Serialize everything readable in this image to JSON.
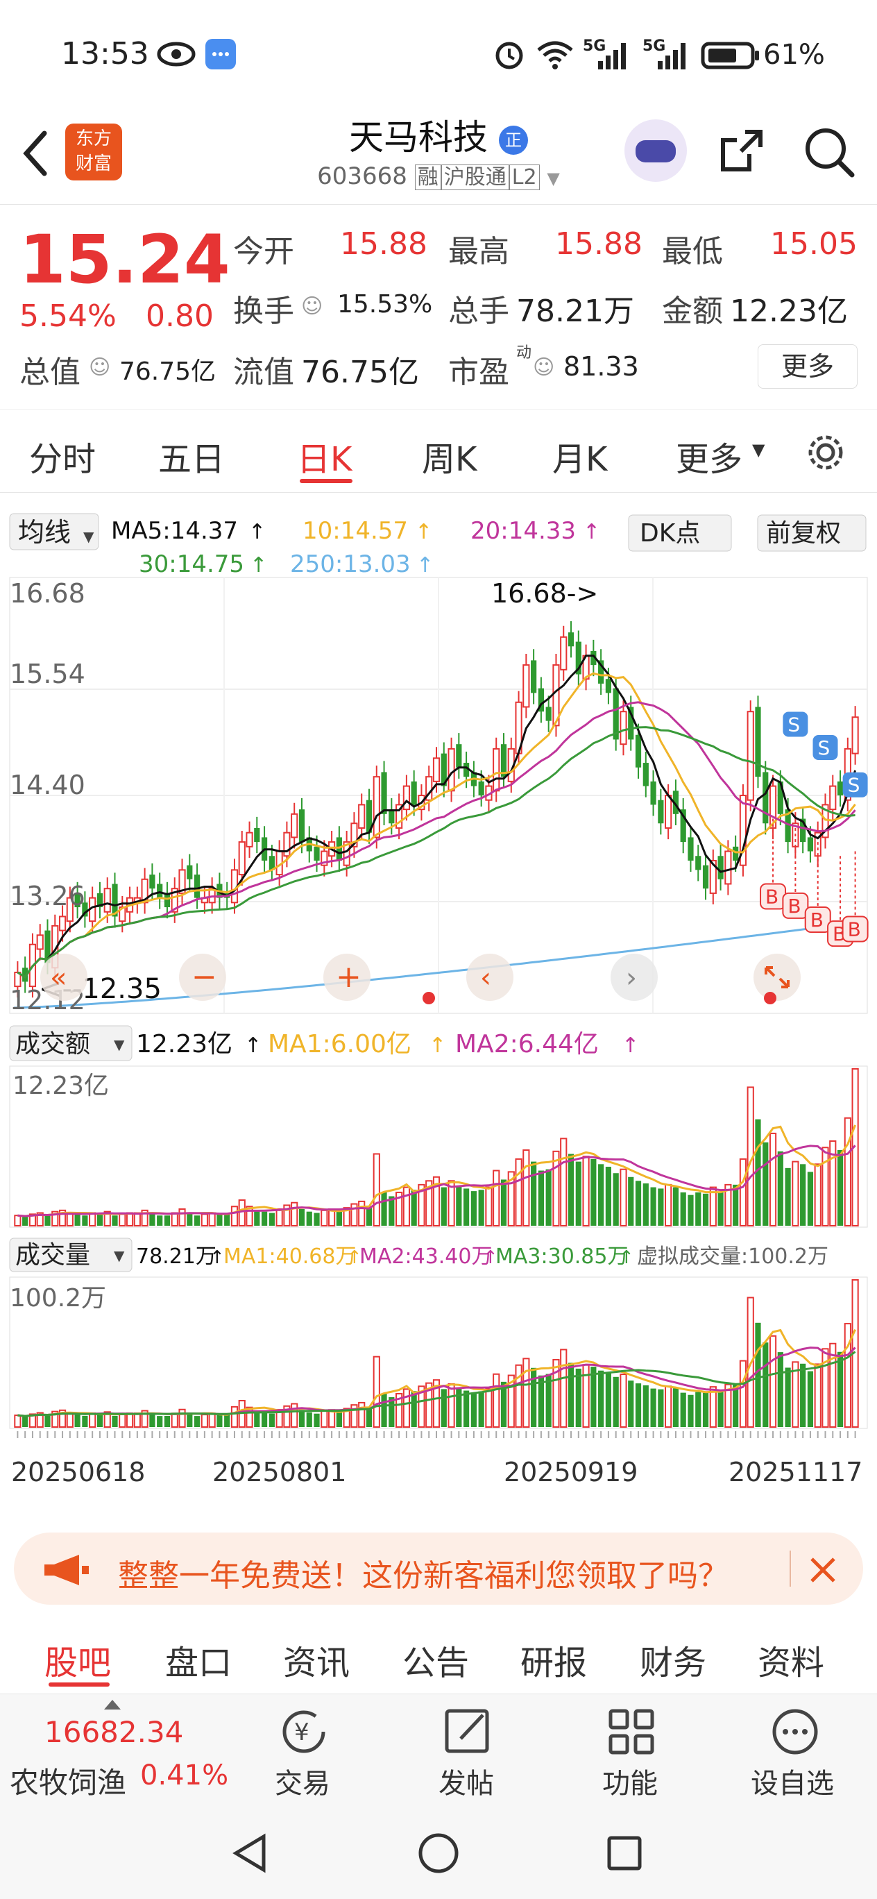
{
  "status": {
    "time": "13:53",
    "battery": "61%",
    "net1": "5G",
    "net2": "5G"
  },
  "header": {
    "title": "天马科技",
    "title_badge": "正",
    "code": "603668",
    "tags": [
      "融",
      "沪股通",
      "L2"
    ],
    "logo_top": "东方",
    "logo_bottom": "财富"
  },
  "quote": {
    "price": "15.24",
    "change_pct": "5.54%",
    "change": "0.80",
    "open_label": "今开",
    "open": "15.88",
    "high_label": "最高",
    "high": "15.88",
    "low_label": "最低",
    "low": "15.05",
    "turnover_label": "换手",
    "turnover": "15.53%",
    "volume_label": "总手",
    "volume": "78.21万",
    "amount_label": "金额",
    "amount": "12.23亿",
    "mcap_label": "总值",
    "mcap": "76.75亿",
    "float_label": "流值",
    "float": "76.75亿",
    "pe_label": "市盈",
    "pe_sup": "动",
    "pe": "81.33",
    "more": "更多"
  },
  "tabs": [
    "分时",
    "五日",
    "日K",
    "周K",
    "月K",
    "更多"
  ],
  "active_tab": "日K",
  "ma": {
    "selector": "均线",
    "ma5": "MA5:14.37",
    "ma10": "10:14.57",
    "ma20": "20:14.33",
    "ma30": "30:14.75",
    "ma250": "250:13.03",
    "dk": "DK点",
    "adj": "前复权"
  },
  "price_axis": [
    "16.68",
    "15.54",
    "14.40",
    "13.26",
    "12.12"
  ],
  "annot_high": "16.68->",
  "annot_low": "<--12.35",
  "amount_panel": {
    "selector": "成交额",
    "value": "12.23亿",
    "ma1": "MA1:6.00亿",
    "ma2": "MA2:6.44亿",
    "axis": "12.23亿"
  },
  "volume_panel": {
    "selector": "成交量",
    "value": "78.21万",
    "ma1": "MA1:40.68万",
    "ma2": "MA2:43.40万",
    "ma3": "MA3:30.85万",
    "virtual": "虚拟成交量:100.2万",
    "axis": "100.2万"
  },
  "dates": [
    "20250618",
    "20250801",
    "20250919",
    "20251117"
  ],
  "banner": {
    "text": "整整一年免费送！这份新客福利您领取了吗？"
  },
  "bottom_tabs": [
    "股吧",
    "盘口",
    "资讯",
    "公告",
    "研报",
    "财务",
    "资料"
  ],
  "index": {
    "value": "16682.34",
    "name": "农牧饲渔",
    "pct": "0.41%"
  },
  "toolbar": {
    "trade": "交易",
    "post": "发帖",
    "func": "功能",
    "watch": "设自选"
  },
  "colors": {
    "up": "#e63434",
    "down": "#2e9a30",
    "ma5": "#111111",
    "ma10": "#f0b429",
    "ma20": "#c0359b",
    "ma30": "#3a9a3a",
    "ma250": "#6cb4e6"
  },
  "chart_data": {
    "type": "candlestick",
    "ylim": [
      12.12,
      16.68
    ],
    "x_ticks": [
      "20250618",
      "20250801",
      "20250919",
      "20251117"
    ],
    "close": [
      12.5,
      12.4,
      12.8,
      12.9,
      12.6,
      13.0,
      13.1,
      13.3,
      13.2,
      13.1,
      13.3,
      13.2,
      13.4,
      13.1,
      13.2,
      13.3,
      13.3,
      13.5,
      13.4,
      13.3,
      13.2,
      13.4,
      13.6,
      13.5,
      13.3,
      13.3,
      13.4,
      13.3,
      13.3,
      13.6,
      13.9,
      14.0,
      13.9,
      13.7,
      13.6,
      13.8,
      14.0,
      14.2,
      13.9,
      13.8,
      13.7,
      13.8,
      13.9,
      13.7,
      13.9,
      14.1,
      14.3,
      14.0,
      14.6,
      14.2,
      14.1,
      14.3,
      14.5,
      14.3,
      14.4,
      14.6,
      14.8,
      14.5,
      14.9,
      14.7,
      14.6,
      14.5,
      14.4,
      14.5,
      14.9,
      14.6,
      14.9,
      15.4,
      15.8,
      15.5,
      15.3,
      15.2,
      15.8,
      16.1,
      16.0,
      15.7,
      15.9,
      15.8,
      15.6,
      15.5,
      15.0,
      15.3,
      15.0,
      14.7,
      14.5,
      14.3,
      14.1,
      14.4,
      14.2,
      13.9,
      13.7,
      13.6,
      13.4,
      13.7,
      13.5,
      13.8,
      13.7,
      14.4,
      15.3,
      14.6,
      14.1,
      14.5,
      14.2,
      13.9,
      14.1,
      13.9,
      13.8,
      14.0,
      14.3,
      14.5,
      14.4,
      14.9,
      15.24
    ],
    "up": [
      1,
      0,
      1,
      1,
      0,
      1,
      1,
      1,
      0,
      0,
      1,
      0,
      1,
      0,
      1,
      1,
      1,
      1,
      0,
      0,
      0,
      1,
      1,
      0,
      0,
      1,
      1,
      0,
      0,
      1,
      1,
      1,
      0,
      0,
      0,
      1,
      1,
      1,
      0,
      0,
      0,
      1,
      1,
      0,
      1,
      1,
      1,
      0,
      1,
      0,
      0,
      1,
      1,
      0,
      1,
      1,
      1,
      0,
      1,
      0,
      0,
      0,
      0,
      1,
      1,
      0,
      1,
      1,
      1,
      0,
      0,
      0,
      1,
      1,
      0,
      0,
      1,
      0,
      0,
      0,
      0,
      1,
      0,
      0,
      0,
      0,
      0,
      1,
      0,
      0,
      0,
      0,
      0,
      1,
      0,
      1,
      0,
      1,
      1,
      0,
      0,
      1,
      0,
      0,
      1,
      0,
      0,
      1,
      1,
      1,
      0,
      1,
      1
    ],
    "amount": [
      0.8,
      0.7,
      0.9,
      1.0,
      0.8,
      1.1,
      1.2,
      1.0,
      0.9,
      0.8,
      1.0,
      0.9,
      1.1,
      0.8,
      0.9,
      1.0,
      1.0,
      1.2,
      0.9,
      0.8,
      0.8,
      1.0,
      1.3,
      1.0,
      0.8,
      0.9,
      1.0,
      0.9,
      0.9,
      1.5,
      2.0,
      1.5,
      1.2,
      1.1,
      1.0,
      1.3,
      1.6,
      1.8,
      1.3,
      1.1,
      1.0,
      1.2,
      1.3,
      1.1,
      1.4,
      1.7,
      1.9,
      1.4,
      5.6,
      2.6,
      2.3,
      2.6,
      3.0,
      2.8,
      3.2,
      3.5,
      3.8,
      3.0,
      3.5,
      3.1,
      2.9,
      2.7,
      2.8,
      3.0,
      4.3,
      3.6,
      4.2,
      5.2,
      5.9,
      5.0,
      4.3,
      4.4,
      5.8,
      6.8,
      5.6,
      5.0,
      5.4,
      5.2,
      4.8,
      4.6,
      4.1,
      4.4,
      3.8,
      3.5,
      3.3,
      3.0,
      2.9,
      3.2,
      3.0,
      2.6,
      2.4,
      2.6,
      2.5,
      3.0,
      2.6,
      3.2,
      3.2,
      5.2,
      10.8,
      8.3,
      6.5,
      7.2,
      5.8,
      4.5,
      5.0,
      4.8,
      4.2,
      4.8,
      6.1,
      6.6,
      5.9,
      8.4,
      12.23
    ]
  }
}
